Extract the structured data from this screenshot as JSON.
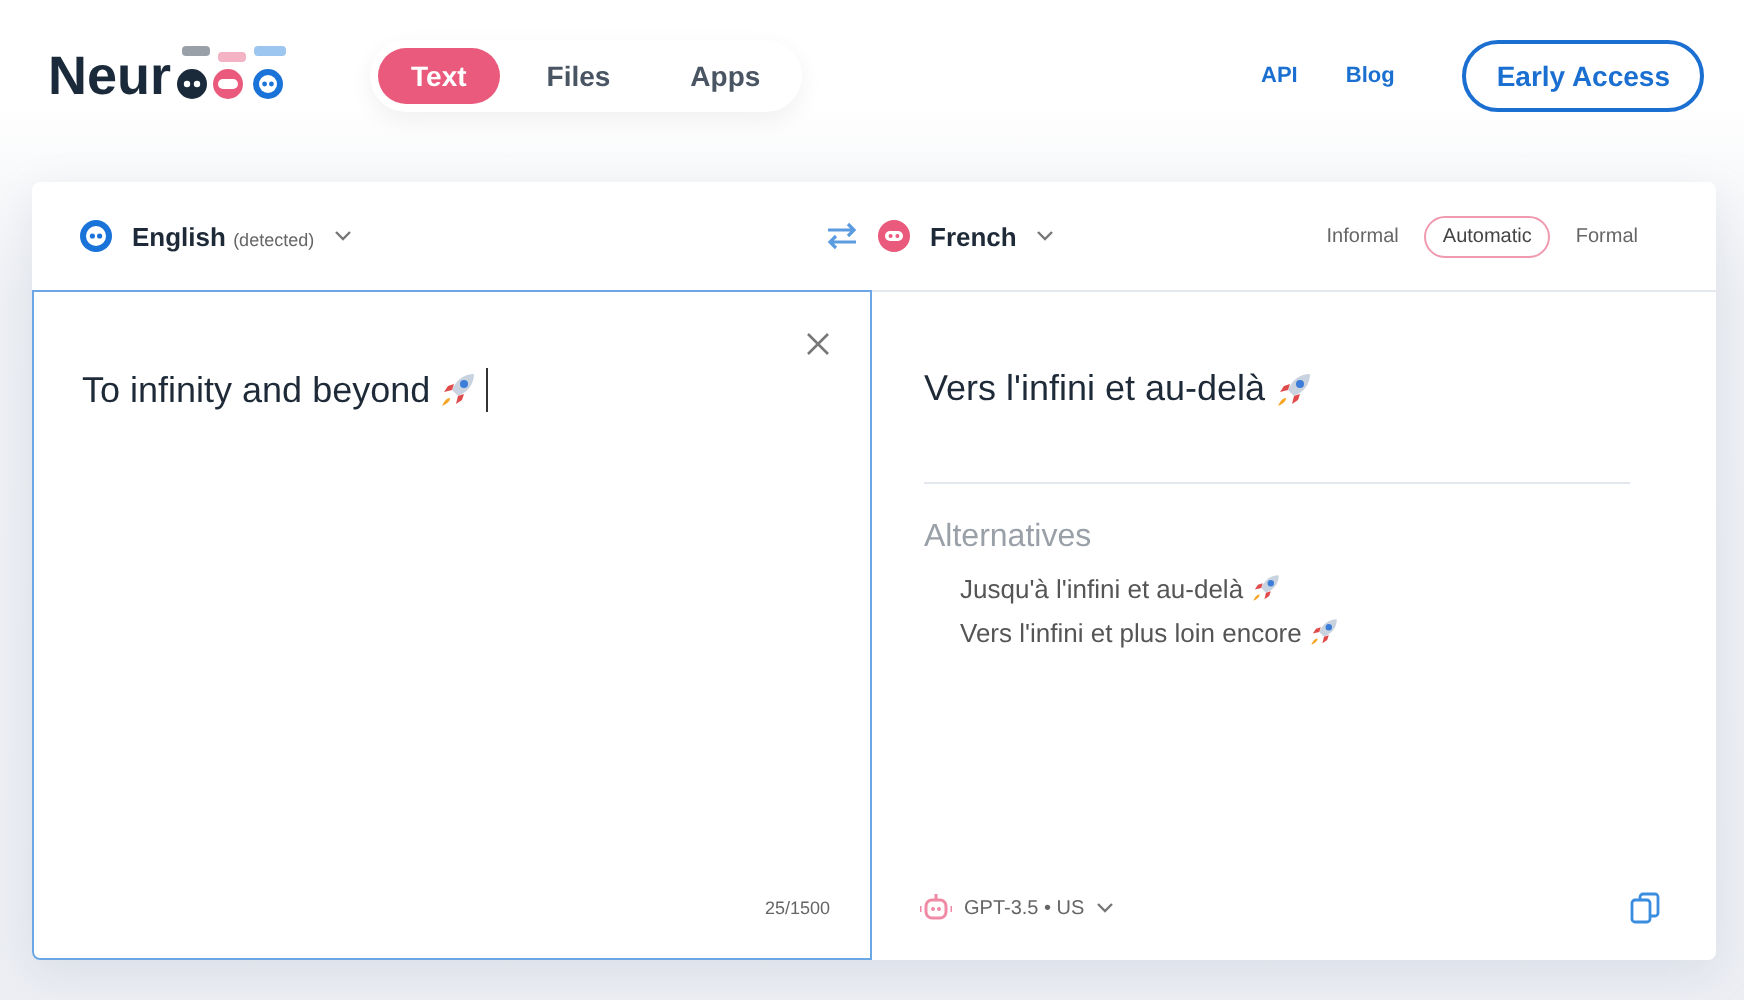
{
  "logo": {
    "text": "Neur"
  },
  "nav_tabs": [
    {
      "label": "Text",
      "selected": true
    },
    {
      "label": "Files",
      "selected": false
    },
    {
      "label": "Apps",
      "selected": false
    }
  ],
  "links": [
    "API",
    "Blog"
  ],
  "cta_button": "Early Access",
  "source": {
    "language": "English",
    "note": "(detected)",
    "text": "To infinity and beyond",
    "counter": "25/1500"
  },
  "target": {
    "language": "French",
    "text": "Vers l'infini et au-delà",
    "model": "GPT-3.5 • US"
  },
  "formality": [
    {
      "label": "Informal",
      "selected": false
    },
    {
      "label": "Automatic",
      "selected": true
    },
    {
      "label": "Formal",
      "selected": false
    }
  ],
  "alternatives": {
    "title": "Alternatives",
    "items": [
      "Jusqu'à l'infini et au-delà",
      "Vers l'infini et plus loin encore"
    ]
  }
}
